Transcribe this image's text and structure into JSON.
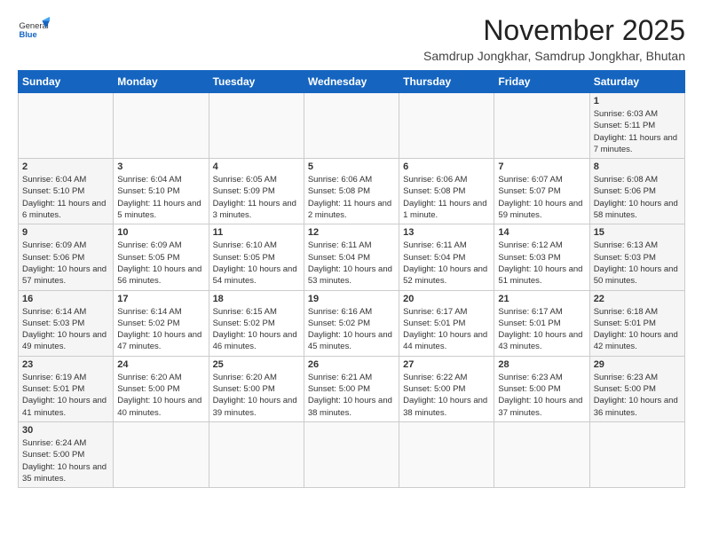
{
  "header": {
    "logo_general": "General",
    "logo_blue": "Blue",
    "month_title": "November 2025",
    "location": "Samdrup Jongkhar, Samdrup Jongkhar, Bhutan"
  },
  "days_of_week": [
    "Sunday",
    "Monday",
    "Tuesday",
    "Wednesday",
    "Thursday",
    "Friday",
    "Saturday"
  ],
  "weeks": [
    [
      {
        "day": "",
        "info": ""
      },
      {
        "day": "",
        "info": ""
      },
      {
        "day": "",
        "info": ""
      },
      {
        "day": "",
        "info": ""
      },
      {
        "day": "",
        "info": ""
      },
      {
        "day": "",
        "info": ""
      },
      {
        "day": "1",
        "info": "Sunrise: 6:03 AM\nSunset: 5:11 PM\nDaylight: 11 hours\nand 7 minutes."
      }
    ],
    [
      {
        "day": "2",
        "info": "Sunrise: 6:04 AM\nSunset: 5:10 PM\nDaylight: 11 hours\nand 6 minutes."
      },
      {
        "day": "3",
        "info": "Sunrise: 6:04 AM\nSunset: 5:10 PM\nDaylight: 11 hours\nand 5 minutes."
      },
      {
        "day": "4",
        "info": "Sunrise: 6:05 AM\nSunset: 5:09 PM\nDaylight: 11 hours\nand 3 minutes."
      },
      {
        "day": "5",
        "info": "Sunrise: 6:06 AM\nSunset: 5:08 PM\nDaylight: 11 hours\nand 2 minutes."
      },
      {
        "day": "6",
        "info": "Sunrise: 6:06 AM\nSunset: 5:08 PM\nDaylight: 11 hours\nand 1 minute."
      },
      {
        "day": "7",
        "info": "Sunrise: 6:07 AM\nSunset: 5:07 PM\nDaylight: 10 hours\nand 59 minutes."
      },
      {
        "day": "8",
        "info": "Sunrise: 6:08 AM\nSunset: 5:06 PM\nDaylight: 10 hours\nand 58 minutes."
      }
    ],
    [
      {
        "day": "9",
        "info": "Sunrise: 6:09 AM\nSunset: 5:06 PM\nDaylight: 10 hours\nand 57 minutes."
      },
      {
        "day": "10",
        "info": "Sunrise: 6:09 AM\nSunset: 5:05 PM\nDaylight: 10 hours\nand 56 minutes."
      },
      {
        "day": "11",
        "info": "Sunrise: 6:10 AM\nSunset: 5:05 PM\nDaylight: 10 hours\nand 54 minutes."
      },
      {
        "day": "12",
        "info": "Sunrise: 6:11 AM\nSunset: 5:04 PM\nDaylight: 10 hours\nand 53 minutes."
      },
      {
        "day": "13",
        "info": "Sunrise: 6:11 AM\nSunset: 5:04 PM\nDaylight: 10 hours\nand 52 minutes."
      },
      {
        "day": "14",
        "info": "Sunrise: 6:12 AM\nSunset: 5:03 PM\nDaylight: 10 hours\nand 51 minutes."
      },
      {
        "day": "15",
        "info": "Sunrise: 6:13 AM\nSunset: 5:03 PM\nDaylight: 10 hours\nand 50 minutes."
      }
    ],
    [
      {
        "day": "16",
        "info": "Sunrise: 6:14 AM\nSunset: 5:03 PM\nDaylight: 10 hours\nand 49 minutes."
      },
      {
        "day": "17",
        "info": "Sunrise: 6:14 AM\nSunset: 5:02 PM\nDaylight: 10 hours\nand 47 minutes."
      },
      {
        "day": "18",
        "info": "Sunrise: 6:15 AM\nSunset: 5:02 PM\nDaylight: 10 hours\nand 46 minutes."
      },
      {
        "day": "19",
        "info": "Sunrise: 6:16 AM\nSunset: 5:02 PM\nDaylight: 10 hours\nand 45 minutes."
      },
      {
        "day": "20",
        "info": "Sunrise: 6:17 AM\nSunset: 5:01 PM\nDaylight: 10 hours\nand 44 minutes."
      },
      {
        "day": "21",
        "info": "Sunrise: 6:17 AM\nSunset: 5:01 PM\nDaylight: 10 hours\nand 43 minutes."
      },
      {
        "day": "22",
        "info": "Sunrise: 6:18 AM\nSunset: 5:01 PM\nDaylight: 10 hours\nand 42 minutes."
      }
    ],
    [
      {
        "day": "23",
        "info": "Sunrise: 6:19 AM\nSunset: 5:01 PM\nDaylight: 10 hours\nand 41 minutes."
      },
      {
        "day": "24",
        "info": "Sunrise: 6:20 AM\nSunset: 5:00 PM\nDaylight: 10 hours\nand 40 minutes."
      },
      {
        "day": "25",
        "info": "Sunrise: 6:20 AM\nSunset: 5:00 PM\nDaylight: 10 hours\nand 39 minutes."
      },
      {
        "day": "26",
        "info": "Sunrise: 6:21 AM\nSunset: 5:00 PM\nDaylight: 10 hours\nand 38 minutes."
      },
      {
        "day": "27",
        "info": "Sunrise: 6:22 AM\nSunset: 5:00 PM\nDaylight: 10 hours\nand 38 minutes."
      },
      {
        "day": "28",
        "info": "Sunrise: 6:23 AM\nSunset: 5:00 PM\nDaylight: 10 hours\nand 37 minutes."
      },
      {
        "day": "29",
        "info": "Sunrise: 6:23 AM\nSunset: 5:00 PM\nDaylight: 10 hours\nand 36 minutes."
      }
    ],
    [
      {
        "day": "30",
        "info": "Sunrise: 6:24 AM\nSunset: 5:00 PM\nDaylight: 10 hours\nand 35 minutes."
      },
      {
        "day": "",
        "info": ""
      },
      {
        "day": "",
        "info": ""
      },
      {
        "day": "",
        "info": ""
      },
      {
        "day": "",
        "info": ""
      },
      {
        "day": "",
        "info": ""
      },
      {
        "day": "",
        "info": ""
      }
    ]
  ]
}
